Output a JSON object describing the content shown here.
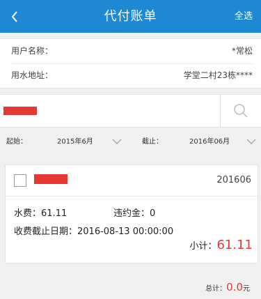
{
  "header": {
    "title": "代付账单",
    "select_all": "全选"
  },
  "info": {
    "user_name_label": "用户名称：",
    "user_name_value": "*常松",
    "address_label": "用水地址：",
    "address_value": "学堂二村23栋****"
  },
  "filter": {
    "start_label": "起始：",
    "start_value": "2015年6月",
    "end_label": "截止：",
    "end_value": "2016年06月"
  },
  "bill": {
    "period": "201606",
    "water_fee_label": "水费：",
    "water_fee": "61.11",
    "penalty_label": "违约金：",
    "penalty": "0",
    "deadline_label": "收费截止日期：",
    "deadline": "2016-08-13 00:00:00",
    "subtotal_label": "小计：",
    "subtotal": "61.11"
  },
  "footer": {
    "total_label": "总计：",
    "total": "0.0",
    "unit": "元"
  },
  "colors": {
    "header": "#1e88d2",
    "accent_red": "#e53935"
  }
}
